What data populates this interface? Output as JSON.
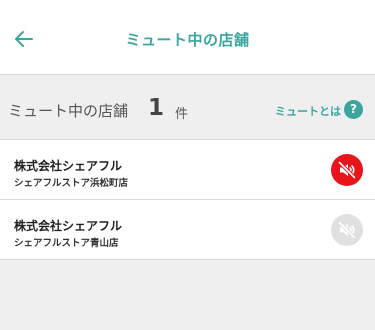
{
  "header": {
    "title": "ミュート中の店舗",
    "back_icon": "arrow-left-icon"
  },
  "summary": {
    "label": "ミュート中の店舗",
    "count": "1",
    "unit": "件",
    "about_link": "ミュートとは",
    "help_icon_text": "?"
  },
  "shops": [
    {
      "name": "株式会社シェアフル",
      "branch": "シェアフルストア浜松町店",
      "muted": true,
      "icon": "speaker-muted-icon",
      "color": "#e8141b"
    },
    {
      "name": "株式会社シェアフル",
      "branch": "シェアフルストア青山店",
      "muted": false,
      "icon": "speaker-muted-icon",
      "color": "#e0e0e0"
    }
  ],
  "colors": {
    "accent": "#3aa59e",
    "muted_active": "#e8141b",
    "muted_inactive": "#e0e0e0"
  }
}
